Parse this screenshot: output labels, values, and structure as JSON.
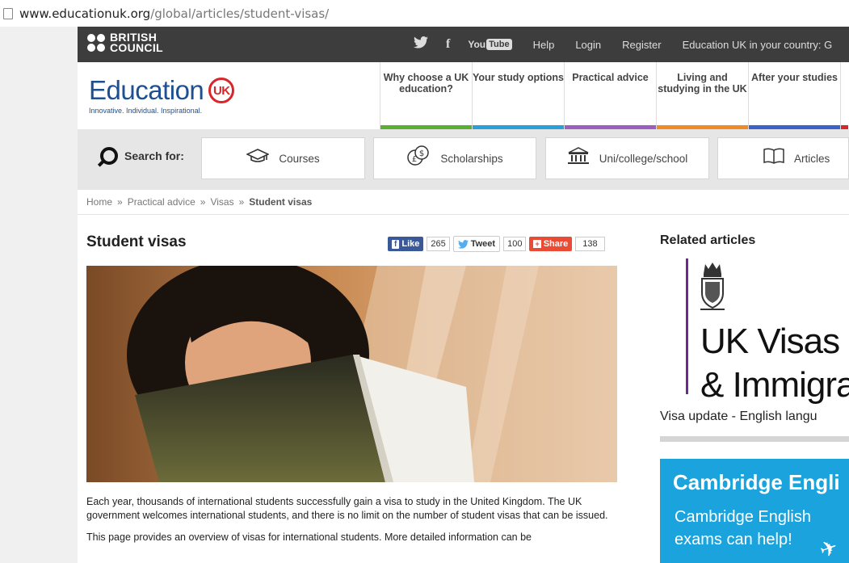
{
  "address_bar": {
    "host": "www.educationuk.org",
    "path": "/global/articles/student-visas/"
  },
  "topbar": {
    "brand_line1": "BRITISH",
    "brand_line2": "COUNCIL",
    "youtube_you": "You",
    "youtube_tube": "Tube",
    "help": "Help",
    "login": "Login",
    "register": "Register",
    "country": "Education UK in your country:  G"
  },
  "logo": {
    "word": "Education",
    "mark": "UK",
    "tagline": "Innovative. Individual. Inspirational."
  },
  "mainnav": [
    {
      "label": "Why choose a UK education?",
      "color": "#5bb031"
    },
    {
      "label": "Your study options",
      "color": "#2a9fd8"
    },
    {
      "label": "Practical advice",
      "color": "#9b5fc0"
    },
    {
      "label": "Living and studying in the UK",
      "color": "#f08a24"
    },
    {
      "label": "After your studies",
      "color": "#3a62c9"
    },
    {
      "label": "",
      "color": "#d9262b"
    }
  ],
  "search": {
    "label": "Search for:",
    "courses": "Courses",
    "scholarships": "Scholarships",
    "institutions": "Uni/college/school",
    "articles": "Articles"
  },
  "breadcrumb": {
    "home": "Home",
    "sep": "»",
    "practical": "Practical advice",
    "visas": "Visas",
    "current": "Student visas"
  },
  "article": {
    "title": "Student visas",
    "para1": "Each year, thousands of international students successfully gain a visa to study in the United Kingdom. The UK government welcomes international students, and there is no limit on the number of student visas that can be issued.",
    "para2": "This page provides an overview of visas for international students. More detailed information can be"
  },
  "share": {
    "like": "Like",
    "like_count": "265",
    "tweet": "Tweet",
    "tweet_count": "100",
    "share": "Share",
    "share_count": "138",
    "facebook_color": "#3b5998",
    "twitter_color": "#55acee",
    "share_color": "#e94b35"
  },
  "related": {
    "title": "Related articles",
    "visa_line1": "UK Visas",
    "visa_line2": "& Immigrat",
    "visa_caption": "Visa update - English langu"
  },
  "ad": {
    "title": "Cambridge Engli",
    "line1": "Cambridge English",
    "line2": "exams can help!"
  }
}
